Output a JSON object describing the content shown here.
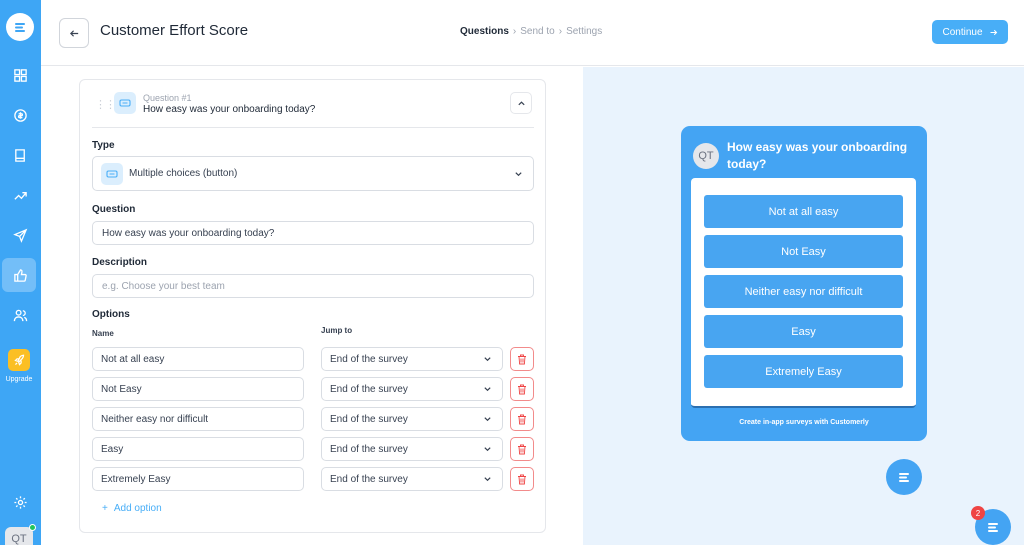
{
  "sidebar": {
    "upgrade_label": "Upgrade",
    "avatar_initials": "QT",
    "accent": "#3ea6f5"
  },
  "header": {
    "title": "Customer Effort Score",
    "steps": [
      "Questions",
      "Send to",
      "Settings"
    ],
    "separator": "›",
    "continue_label": "Continue"
  },
  "question": {
    "number_label": "Question #1",
    "title": "How easy was your onboarding today?",
    "type_label": "Type",
    "type_value": "Multiple choices (button)",
    "question_label": "Question",
    "question_value": "How easy was your onboarding today?",
    "description_label": "Description",
    "description_placeholder": "e.g. Choose your best team",
    "options_label": "Options",
    "name_col": "Name",
    "jump_col": "Jump to",
    "options": [
      {
        "name": "Not at all easy",
        "jump": "End of the survey"
      },
      {
        "name": "Not Easy",
        "jump": "End of the survey"
      },
      {
        "name": "Neither easy nor difficult",
        "jump": "End of the survey"
      },
      {
        "name": "Easy",
        "jump": "End of the survey"
      },
      {
        "name": "Extremely Easy",
        "jump": "End of the survey"
      }
    ],
    "add_option_label": "Add option"
  },
  "preview": {
    "avatar_initials": "QT",
    "title": "How easy was your onboarding today?",
    "choices": [
      "Not at all easy",
      "Not Easy",
      "Neither easy nor difficult",
      "Easy",
      "Extremely Easy"
    ],
    "footer": "Create in-app surveys with Customerly",
    "badge_count": "2",
    "accent": "#44a4f3"
  }
}
